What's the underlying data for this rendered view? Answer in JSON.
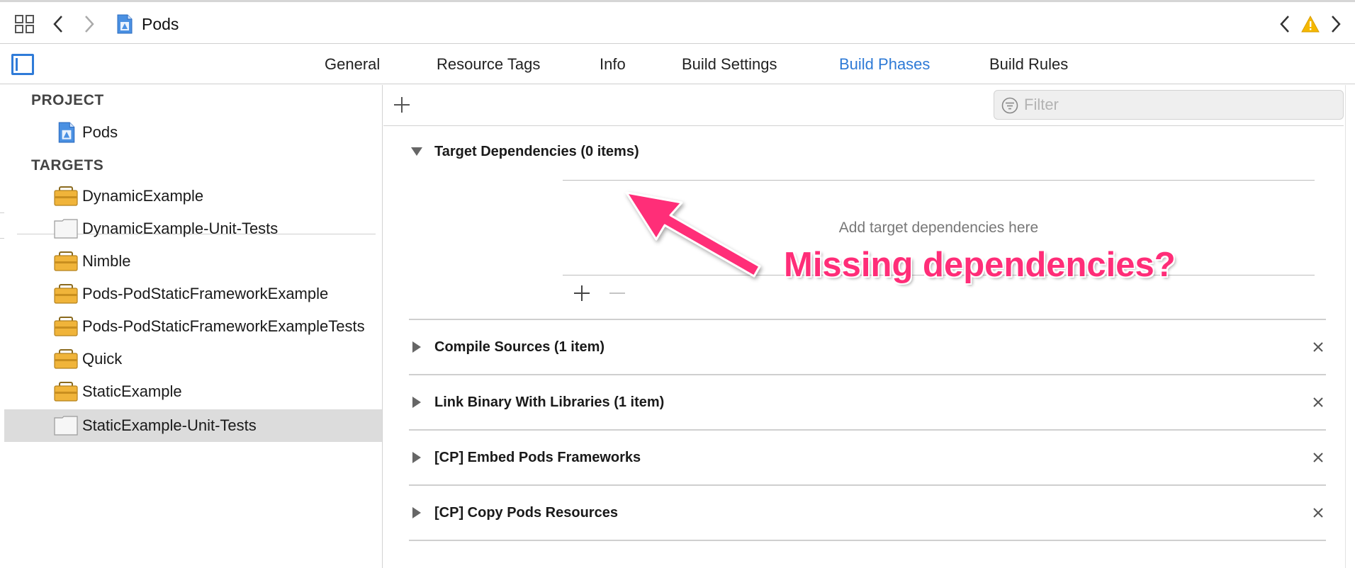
{
  "window": {
    "title": "Pods"
  },
  "jumpbar": {
    "icons": [
      "related-items-grid-icon",
      "back-chevron-icon",
      "forward-chevron-icon",
      "xcode-project-icon",
      "previous-issue-icon",
      "warning-icon",
      "next-issue-icon"
    ]
  },
  "tabs": [
    {
      "label": "General",
      "active": false
    },
    {
      "label": "Resource Tags",
      "active": false
    },
    {
      "label": "Info",
      "active": false
    },
    {
      "label": "Build Settings",
      "active": false
    },
    {
      "label": "Build Phases",
      "active": true
    },
    {
      "label": "Build Rules",
      "active": false
    }
  ],
  "sidebar": {
    "project_header": "PROJECT",
    "project_items": [
      {
        "label": "Pods",
        "icon": "xcode-project-icon"
      }
    ],
    "targets_header": "TARGETS",
    "target_items": [
      {
        "label": "DynamicExample",
        "icon": "framework-target-icon",
        "selected": false
      },
      {
        "label": "DynamicExample-Unit-Tests",
        "icon": "test-bundle-icon",
        "selected": false
      },
      {
        "label": "Nimble",
        "icon": "framework-target-icon",
        "selected": false
      },
      {
        "label": "Pods-PodStaticFrameworkExample",
        "icon": "framework-target-icon",
        "selected": false
      },
      {
        "label": "Pods-PodStaticFrameworkExampleTests",
        "icon": "framework-target-icon",
        "selected": false
      },
      {
        "label": "Quick",
        "icon": "framework-target-icon",
        "selected": false
      },
      {
        "label": "StaticExample",
        "icon": "framework-target-icon",
        "selected": false
      },
      {
        "label": "StaticExample-Unit-Tests",
        "icon": "test-bundle-icon",
        "selected": true
      }
    ]
  },
  "toolbar": {
    "filter_placeholder": "Filter",
    "filter_value": ""
  },
  "phases": [
    {
      "title": "Target Dependencies (0 items)",
      "expanded": true,
      "closable": false,
      "empty_text": "Add target dependencies here"
    },
    {
      "title": "Compile Sources (1 item)",
      "expanded": false,
      "closable": true
    },
    {
      "title": "Link Binary With Libraries (1 item)",
      "expanded": false,
      "closable": true
    },
    {
      "title": "[CP] Embed Pods Frameworks",
      "expanded": false,
      "closable": true
    },
    {
      "title": "[CP] Copy Pods Resources",
      "expanded": false,
      "closable": true
    }
  ],
  "annotation": {
    "text": "Missing dependencies?",
    "color": "#ff2d78"
  },
  "colors": {
    "accent": "#2e7ad6",
    "selection": "#dcdcdc",
    "warning": "#f5b800"
  }
}
